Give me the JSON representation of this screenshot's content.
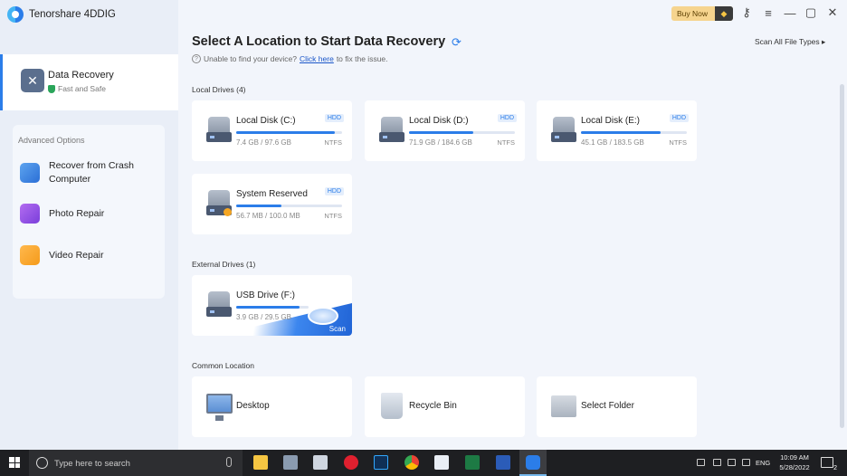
{
  "app": {
    "name": "Tenorshare 4DDIG"
  },
  "titlebar": {
    "buy_now": "Buy Now"
  },
  "sidebar": {
    "active": {
      "title": "Data Recovery",
      "subtitle": "Fast and Safe"
    },
    "advanced_title": "Advanced Options",
    "advanced": [
      {
        "label": "Recover from Crash Computer",
        "icon": "crash-computer-icon"
      },
      {
        "label": "Photo Repair",
        "icon": "photo-repair-icon"
      },
      {
        "label": "Video Repair",
        "icon": "video-repair-icon"
      }
    ]
  },
  "main": {
    "title": "Select A Location to Start Data Recovery",
    "help_prefix": "Unable to find your device?",
    "help_link": "Click here",
    "help_suffix": "to fix the issue.",
    "scan_all": "Scan All File Types"
  },
  "local_drives": {
    "label": "Local Drives (4)",
    "items": [
      {
        "name": "Local Disk (C:)",
        "type": "HDD",
        "size": "7.4 GB / 97.6 GB",
        "fs": "NTFS",
        "used_pct": 93
      },
      {
        "name": "Local Disk (D:)",
        "type": "HDD",
        "size": "71.9 GB / 184.6 GB",
        "fs": "NTFS",
        "used_pct": 61
      },
      {
        "name": "Local Disk (E:)",
        "type": "HDD",
        "size": "45.1 GB / 183.5 GB",
        "fs": "NTFS",
        "used_pct": 75
      },
      {
        "name": "System Reserved",
        "type": "HDD",
        "size": "56.7 MB / 100.0 MB",
        "fs": "NTFS",
        "used_pct": 43
      }
    ]
  },
  "external_drives": {
    "label": "External Drives (1)",
    "items": [
      {
        "name": "USB Drive (F:)",
        "size": "3.9 GB / 29.5 GB",
        "used_pct": 87,
        "action": "Scan"
      }
    ]
  },
  "common": {
    "label": "Common Location",
    "items": [
      {
        "name": "Desktop",
        "icon": "desktop-icon"
      },
      {
        "name": "Recycle Bin",
        "icon": "recycle-bin-icon"
      },
      {
        "name": "Select Folder",
        "icon": "folder-icon"
      }
    ]
  },
  "taskbar": {
    "search_placeholder": "Type here to search",
    "lang": "ENG",
    "time": "10:09 AM",
    "date": "5/28/2022",
    "notification_count": "2"
  }
}
